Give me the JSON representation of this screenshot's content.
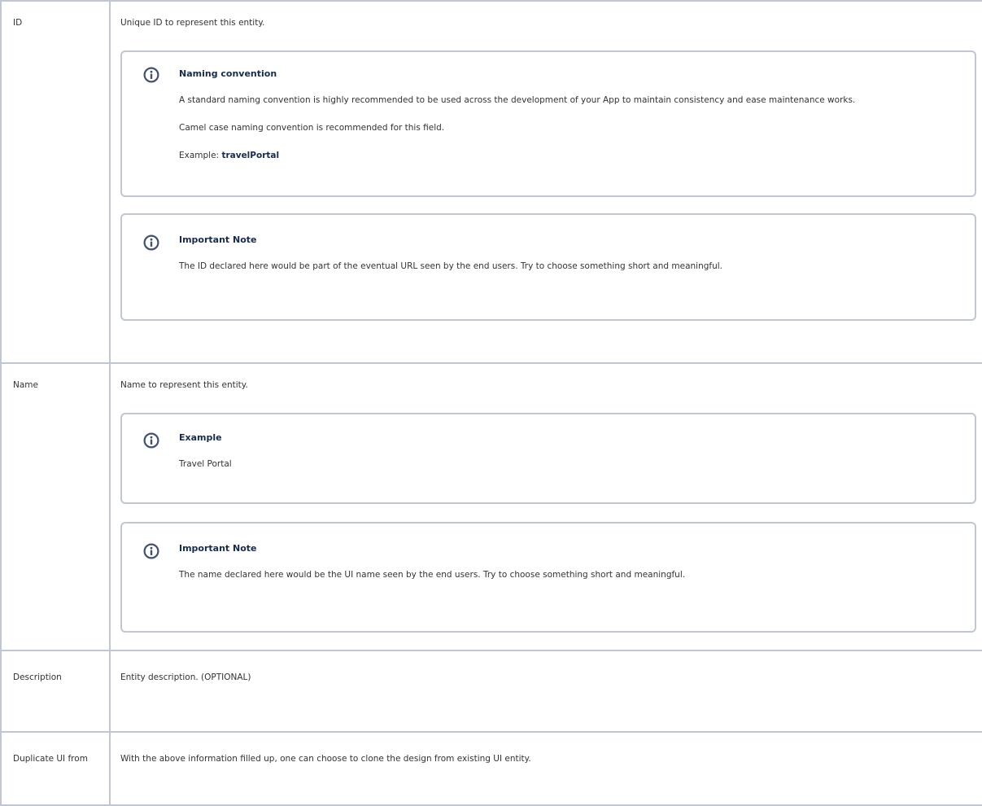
{
  "rows": [
    {
      "key": "ID",
      "description": "Unique ID to represent this entity.",
      "panels": [
        {
          "title": "Naming convention",
          "paragraphs": [
            "A standard naming convention is highly recommended to be used across the development of your App to maintain consistency and ease maintenance works.",
            "Camel case naming convention is recommended for this field."
          ],
          "example_label": "Example: ",
          "example_value": "travelPortal"
        },
        {
          "title": "Important Note",
          "paragraphs": [
            "The ID declared here would be part of the eventual URL seen by the end users. Try to choose something short and meaningful."
          ]
        }
      ]
    },
    {
      "key": "Name",
      "description": "Name to represent this entity.",
      "panels": [
        {
          "title": "Example",
          "paragraphs": [
            "Travel Portal"
          ]
        },
        {
          "title": "Important Note",
          "paragraphs": [
            "The name declared here would be the UI name seen by the end users. Try to choose something short and meaningful."
          ]
        }
      ]
    },
    {
      "key": "Description",
      "description": "Entity description. (OPTIONAL)"
    },
    {
      "key": "Duplicate UI from",
      "description": "With the above information filled up, one can choose to clone the design from existing UI entity."
    }
  ],
  "icons": {
    "panel_icon": "info-circle-icon"
  },
  "colors": {
    "icon": "#42526e",
    "border": "#c1c7d0"
  }
}
